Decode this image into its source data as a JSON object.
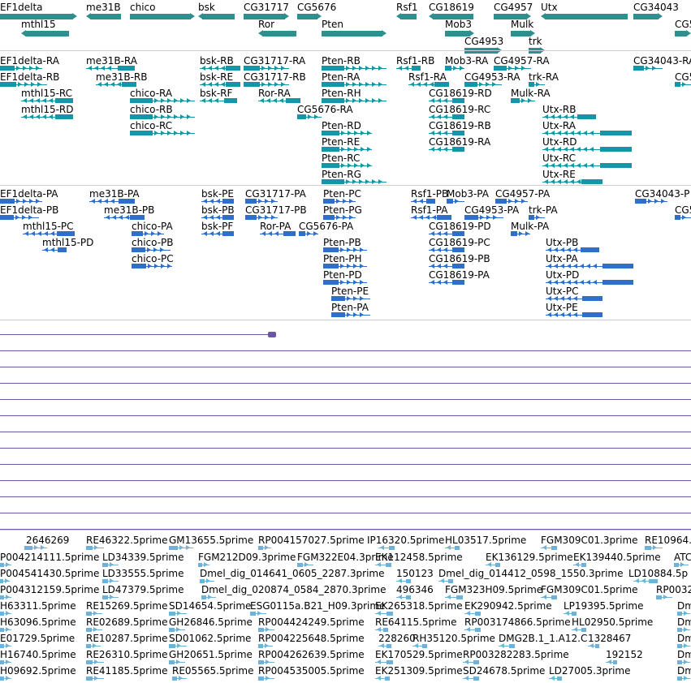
{
  "colors": {
    "gene": "#2f8f8f",
    "transcript": "#1495a8",
    "protein": "#2f6fc9",
    "est": "#6fb2d8",
    "xy_line": "#6a55a8"
  },
  "tracks": {
    "genes": {
      "features": [
        {
          "label": "EF1delta",
          "dir": "right"
        },
        {
          "label": "mthl15",
          "dir": "left"
        },
        {
          "label": "me31B",
          "dir": "left"
        },
        {
          "label": "chico",
          "dir": "right"
        },
        {
          "label": "bsk",
          "dir": "left"
        },
        {
          "label": "CG31717",
          "dir": "right"
        },
        {
          "label": "Ror",
          "dir": "left"
        },
        {
          "label": "CG5676",
          "dir": "right"
        },
        {
          "label": "Pten",
          "dir": "right"
        },
        {
          "label": "Rsf1",
          "dir": "left"
        },
        {
          "label": "CG18619",
          "dir": "left"
        },
        {
          "label": "Mob3",
          "dir": "right"
        },
        {
          "label": "CG4953",
          "dir": "right"
        },
        {
          "label": "CG4957",
          "dir": "right"
        },
        {
          "label": "Mulk",
          "dir": "right"
        },
        {
          "label": "trk",
          "dir": "right"
        },
        {
          "label": "Utx",
          "dir": "left"
        },
        {
          "label": "CG34043",
          "dir": "right"
        },
        {
          "label": "CG5",
          "dir": "right"
        }
      ]
    },
    "transcripts": {
      "features": [
        {
          "label": "EF1delta-RA",
          "dir": "right"
        },
        {
          "label": "EF1delta-RB",
          "dir": "right"
        },
        {
          "label": "mthl15-RC",
          "dir": "left"
        },
        {
          "label": "mthl15-RD",
          "dir": "left"
        },
        {
          "label": "me31B-RA",
          "dir": "left"
        },
        {
          "label": "me31B-RB",
          "dir": "left"
        },
        {
          "label": "chico-RA",
          "dir": "right"
        },
        {
          "label": "chico-RB",
          "dir": "right"
        },
        {
          "label": "chico-RC",
          "dir": "right"
        },
        {
          "label": "bsk-RB",
          "dir": "left"
        },
        {
          "label": "bsk-RE",
          "dir": "left"
        },
        {
          "label": "bsk-RF",
          "dir": "left"
        },
        {
          "label": "CG31717-RA",
          "dir": "right"
        },
        {
          "label": "CG31717-RB",
          "dir": "right"
        },
        {
          "label": "Ror-RA",
          "dir": "left"
        },
        {
          "label": "CG5676-RA",
          "dir": "right"
        },
        {
          "label": "Pten-RB",
          "dir": "right"
        },
        {
          "label": "Pten-RA",
          "dir": "right"
        },
        {
          "label": "Pten-RH",
          "dir": "right"
        },
        {
          "label": "Pten-RD",
          "dir": "right"
        },
        {
          "label": "Pten-RE",
          "dir": "right"
        },
        {
          "label": "Pten-RC",
          "dir": "right"
        },
        {
          "label": "Pten-RG",
          "dir": "right"
        },
        {
          "label": "Rsf1-RB",
          "dir": "left"
        },
        {
          "label": "Rsf1-RA",
          "dir": "left"
        },
        {
          "label": "Mob3-RA",
          "dir": "right"
        },
        {
          "label": "CG4953-RA",
          "dir": "right"
        },
        {
          "label": "CG18619-RD",
          "dir": "left"
        },
        {
          "label": "CG18619-RC",
          "dir": "left"
        },
        {
          "label": "CG18619-RB",
          "dir": "left"
        },
        {
          "label": "CG18619-RA",
          "dir": "left"
        },
        {
          "label": "CG4957-RA",
          "dir": "right"
        },
        {
          "label": "trk-RA",
          "dir": "right"
        },
        {
          "label": "Mulk-RA",
          "dir": "right"
        },
        {
          "label": "Utx-RB",
          "dir": "left"
        },
        {
          "label": "Utx-RA",
          "dir": "left"
        },
        {
          "label": "Utx-RD",
          "dir": "left"
        },
        {
          "label": "Utx-RC",
          "dir": "left"
        },
        {
          "label": "Utx-RE",
          "dir": "left"
        },
        {
          "label": "CG34043-RA",
          "dir": "right"
        },
        {
          "label": "CG5",
          "dir": "right"
        }
      ]
    },
    "proteins": {
      "features": [
        {
          "label": "EF1delta-PA",
          "dir": "right"
        },
        {
          "label": "EF1delta-PB",
          "dir": "right"
        },
        {
          "label": "mthl15-PC",
          "dir": "left"
        },
        {
          "label": "mthl15-PD",
          "dir": "left"
        },
        {
          "label": "me31B-PA",
          "dir": "left"
        },
        {
          "label": "me31B-PB",
          "dir": "left"
        },
        {
          "label": "chico-PA",
          "dir": "right"
        },
        {
          "label": "chico-PB",
          "dir": "right"
        },
        {
          "label": "chico-PC",
          "dir": "right"
        },
        {
          "label": "bsk-PE",
          "dir": "left"
        },
        {
          "label": "bsk-PB",
          "dir": "left"
        },
        {
          "label": "bsk-PF",
          "dir": "left"
        },
        {
          "label": "CG31717-PA",
          "dir": "right"
        },
        {
          "label": "CG31717-PB",
          "dir": "right"
        },
        {
          "label": "Ror-PA",
          "dir": "left"
        },
        {
          "label": "CG5676-PA",
          "dir": "right"
        },
        {
          "label": "Pten-PC",
          "dir": "right"
        },
        {
          "label": "Pten-PG",
          "dir": "right"
        },
        {
          "label": "Pten-PB",
          "dir": "right"
        },
        {
          "label": "Pten-PH",
          "dir": "right"
        },
        {
          "label": "Pten-PD",
          "dir": "right"
        },
        {
          "label": "Pten-PE",
          "dir": "right"
        },
        {
          "label": "Pten-PA",
          "dir": "right"
        },
        {
          "label": "Rsf1-PB",
          "dir": "left"
        },
        {
          "label": "Rsf1-PA",
          "dir": "left"
        },
        {
          "label": "Mob3-PA",
          "dir": "right"
        },
        {
          "label": "CG4953-PA",
          "dir": "right"
        },
        {
          "label": "CG4957-PA",
          "dir": "right"
        },
        {
          "label": "CG18619-PD",
          "dir": "left"
        },
        {
          "label": "CG18619-PC",
          "dir": "left"
        },
        {
          "label": "CG18619-PB",
          "dir": "left"
        },
        {
          "label": "CG18619-PA",
          "dir": "left"
        },
        {
          "label": "trk-PA",
          "dir": "right"
        },
        {
          "label": "Mulk-PA",
          "dir": "right"
        },
        {
          "label": "Utx-PB",
          "dir": "left"
        },
        {
          "label": "Utx-PA",
          "dir": "left"
        },
        {
          "label": "Utx-PD",
          "dir": "left"
        },
        {
          "label": "Utx-PC",
          "dir": "left"
        },
        {
          "label": "Utx-PE",
          "dir": "left"
        },
        {
          "label": "CG34043-P",
          "dir": "right"
        },
        {
          "label": "CG5",
          "dir": "right"
        }
      ]
    },
    "ests": {
      "features": [
        {
          "label": "2646269",
          "dir": "right"
        },
        {
          "label": "RE46322.5prime",
          "dir": "right"
        },
        {
          "label": "GM13655.5prime",
          "dir": "right"
        },
        {
          "label": "RP004157027.5prime",
          "dir": "right"
        },
        {
          "label": "IP16320.5prime",
          "dir": "left"
        },
        {
          "label": "HL03517.5prime",
          "dir": "left"
        },
        {
          "label": "FGM309C01.3prime",
          "dir": "left"
        },
        {
          "label": "RE10964.",
          "dir": "right"
        },
        {
          "label": "P004214111.5prime",
          "dir": "right"
        },
        {
          "label": "LD34339.5prime",
          "dir": "right"
        },
        {
          "label": "FGM212D09.3prime",
          "dir": "right"
        },
        {
          "label": "FGM322E04.3prime",
          "dir": "right"
        },
        {
          "label": "EK112458.5prime",
          "dir": "left"
        },
        {
          "label": "EK136129.5prime",
          "dir": "left"
        },
        {
          "label": "EK139440.5prime",
          "dir": "left"
        },
        {
          "label": "ATC",
          "dir": "right"
        },
        {
          "label": "P004541430.5prime",
          "dir": "right"
        },
        {
          "label": "LD33555.5prime",
          "dir": "right"
        },
        {
          "label": "Dmel_dig_014641_0605_2287.3prime",
          "dir": "right"
        },
        {
          "label": "150123",
          "dir": "left"
        },
        {
          "label": "Dmel_dig_014412_0598_1550.3prime",
          "dir": "left"
        },
        {
          "label": "LD10884.5p",
          "dir": "left"
        },
        {
          "label": "P004312159.5prime",
          "dir": "right"
        },
        {
          "label": "LD47379.5prime",
          "dir": "right"
        },
        {
          "label": "Dmel_dig_020874_0584_2870.3prime",
          "dir": "right"
        },
        {
          "label": "496346",
          "dir": "left"
        },
        {
          "label": "FGM323H09.5prime",
          "dir": "left"
        },
        {
          "label": "FGM309C01.5prime",
          "dir": "left"
        },
        {
          "label": "RP0032",
          "dir": "right"
        },
        {
          "label": "H63311.5prime",
          "dir": "right"
        },
        {
          "label": "RE15269.5prime",
          "dir": "right"
        },
        {
          "label": "SD14654.5prime",
          "dir": "right"
        },
        {
          "label": "ESG0115a.B21_H09.3prime",
          "dir": "right"
        },
        {
          "label": "EK265318.5prime",
          "dir": "left"
        },
        {
          "label": "EK290942.5prime",
          "dir": "left"
        },
        {
          "label": "LP19395.5prime",
          "dir": "left"
        },
        {
          "label": "Dm",
          "dir": "right"
        },
        {
          "label": "H63096.5prime",
          "dir": "right"
        },
        {
          "label": "RE02689.5prime",
          "dir": "right"
        },
        {
          "label": "GH26846.5prime",
          "dir": "right"
        },
        {
          "label": "RP004424249.5prime",
          "dir": "right"
        },
        {
          "label": "RE64115.5prime",
          "dir": "left"
        },
        {
          "label": "RP003174866.5prime",
          "dir": "left"
        },
        {
          "label": "HL02950.5prime",
          "dir": "left"
        },
        {
          "label": "Dm",
          "dir": "right"
        },
        {
          "label": "E01729.5prime",
          "dir": "right"
        },
        {
          "label": "RE10287.5prime",
          "dir": "right"
        },
        {
          "label": "SD01062.5prime",
          "dir": "right"
        },
        {
          "label": "RP004225648.5prime",
          "dir": "right"
        },
        {
          "label": "228260",
          "dir": "left"
        },
        {
          "label": "RH35120.5prime",
          "dir": "left"
        },
        {
          "label": "DMG2B.1_1.A12.C",
          "dir": "left"
        },
        {
          "label": "1328467",
          "dir": "left"
        },
        {
          "label": "Dm",
          "dir": "right"
        },
        {
          "label": "H16740.5prime",
          "dir": "right"
        },
        {
          "label": "RE26310.5prime",
          "dir": "right"
        },
        {
          "label": "GH20651.5prime",
          "dir": "right"
        },
        {
          "label": "RP004262639.5prime",
          "dir": "right"
        },
        {
          "label": "EK170529.5prime",
          "dir": "left"
        },
        {
          "label": "RP003282283.5prime",
          "dir": "left"
        },
        {
          "label": "192152",
          "dir": "left"
        },
        {
          "label": "Dm",
          "dir": "right"
        },
        {
          "label": "H09692.5prime",
          "dir": "right"
        },
        {
          "label": "RE41185.5prime",
          "dir": "right"
        },
        {
          "label": "RE05565.5prime",
          "dir": "right"
        },
        {
          "label": "RP004535005.5prime",
          "dir": "right"
        },
        {
          "label": "EK251309.5prime",
          "dir": "left"
        },
        {
          "label": "SD24678.5prime",
          "dir": "left"
        },
        {
          "label": "LD27005.3prime",
          "dir": "left"
        },
        {
          "label": "Dm",
          "dir": "right"
        }
      ]
    },
    "xy_track": {
      "line_count": 12
    }
  }
}
